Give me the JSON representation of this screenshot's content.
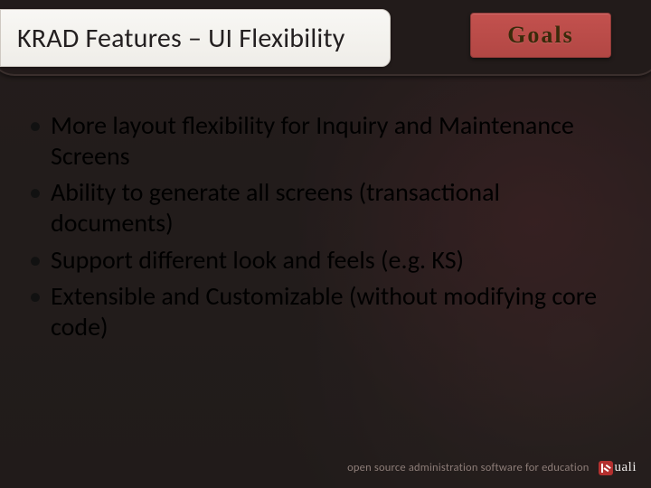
{
  "header": {
    "title": "KRAD Features – UI Flexibility",
    "badge": "Goals"
  },
  "bullets": [
    "More layout flexibility for Inquiry and Maintenance Screens",
    "Ability to generate all screens (transactional documents)",
    "Support different look and feels (e.g. KS)",
    "Extensible and Customizable (without modifying core code)"
  ],
  "footer": {
    "tagline": "open source administration software for education",
    "logo_word": "uali"
  }
}
